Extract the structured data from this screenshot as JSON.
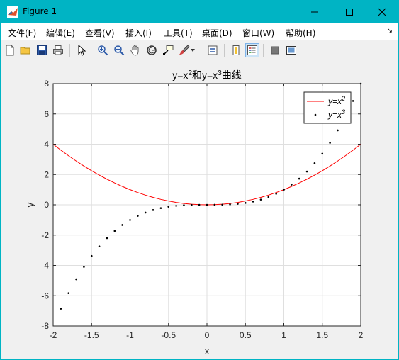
{
  "window": {
    "title": "Figure 1",
    "minimize_label": "—",
    "maximize_label": "☐",
    "close_label": "✕"
  },
  "menubar": {
    "items": [
      "文件(F)",
      "编辑(E)",
      "查看(V)",
      "插入(I)",
      "工具(T)",
      "桌面(D)",
      "窗口(W)",
      "帮助(H)"
    ]
  },
  "toolbar": {
    "icons": [
      "new-figure-icon",
      "open-file-icon",
      "save-icon",
      "print-icon",
      "pointer-icon",
      "zoom-in-icon",
      "zoom-out-icon",
      "pan-icon",
      "rotate-3d-icon",
      "data-cursor-icon",
      "brush-icon",
      "link-plot-icon",
      "colorbar-icon",
      "legend-icon",
      "hide-plot-tools-icon",
      "show-plot-tools-icon"
    ]
  },
  "chart_data": {
    "type": "line",
    "title_parts": {
      "a": "y=x",
      "a_sup": "2",
      "b": "和y=x",
      "b_sup": "3",
      "c": "曲线"
    },
    "xlabel": "x",
    "ylabel": "y",
    "xlim": [
      -2,
      2
    ],
    "ylim": [
      -8,
      8
    ],
    "xticks": [
      "-2",
      "-1.5",
      "-1",
      "-0.5",
      "0",
      "0.5",
      "1",
      "1.5",
      "2"
    ],
    "yticks": [
      "8",
      "6",
      "4",
      "2",
      "0",
      "-2",
      "-4",
      "-6",
      "-8"
    ],
    "grid": true,
    "legend_position": "top-right",
    "series": [
      {
        "name": "y=x",
        "name_sup": "2",
        "style": "line",
        "color": "#ff0000",
        "x": [
          -2.0,
          -1.9,
          -1.8,
          -1.7,
          -1.6,
          -1.5,
          -1.4,
          -1.3,
          -1.2,
          -1.1,
          -1.0,
          -0.9,
          -0.8,
          -0.7,
          -0.6,
          -0.5,
          -0.4,
          -0.3,
          -0.2,
          -0.1,
          0.0,
          0.1,
          0.2,
          0.3,
          0.4,
          0.5,
          0.6,
          0.7,
          0.8,
          0.9,
          1.0,
          1.1,
          1.2,
          1.3,
          1.4,
          1.5,
          1.6,
          1.7,
          1.8,
          1.9,
          2.0
        ],
        "y": [
          4.0,
          3.61,
          3.24,
          2.89,
          2.56,
          2.25,
          1.96,
          1.69,
          1.44,
          1.21,
          1.0,
          0.81,
          0.64,
          0.49,
          0.36,
          0.25,
          0.16,
          0.09,
          0.04,
          0.01,
          0.0,
          0.01,
          0.04,
          0.09,
          0.16,
          0.25,
          0.36,
          0.49,
          0.64,
          0.81,
          1.0,
          1.21,
          1.44,
          1.69,
          1.96,
          2.25,
          2.56,
          2.89,
          3.24,
          3.61,
          4.0
        ]
      },
      {
        "name": "y=x",
        "name_sup": "3",
        "style": "points",
        "color": "#000000",
        "x": [
          -1.9,
          -1.8,
          -1.7,
          -1.6,
          -1.5,
          -1.4,
          -1.3,
          -1.2,
          -1.1,
          -1.0,
          -0.9,
          -0.8,
          -0.7,
          -0.6,
          -0.5,
          -0.4,
          -0.3,
          -0.2,
          -0.1,
          0.0,
          0.1,
          0.2,
          0.3,
          0.4,
          0.5,
          0.6,
          0.7,
          0.8,
          0.9,
          1.0,
          1.1,
          1.2,
          1.3,
          1.4,
          1.5,
          1.6,
          1.7,
          1.8,
          1.9,
          2.0
        ],
        "y": [
          -6.859,
          -5.832,
          -4.913,
          -4.096,
          -3.375,
          -2.744,
          -2.197,
          -1.728,
          -1.331,
          -1.0,
          -0.729,
          -0.512,
          -0.343,
          -0.216,
          -0.125,
          -0.064,
          -0.027,
          -0.008,
          -0.001,
          0.0,
          0.001,
          0.008,
          0.027,
          0.064,
          0.125,
          0.216,
          0.343,
          0.512,
          0.729,
          1.0,
          1.331,
          1.728,
          2.197,
          2.744,
          3.375,
          4.096,
          4.913,
          5.832,
          6.859,
          8.0
        ]
      }
    ]
  }
}
